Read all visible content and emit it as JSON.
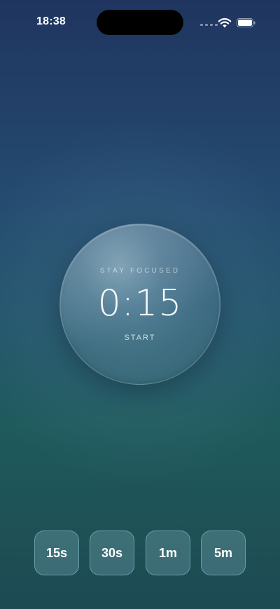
{
  "status_bar": {
    "time": "18:38",
    "icons": [
      "cellular-signal-icon",
      "wifi-icon",
      "battery-icon"
    ]
  },
  "timer": {
    "subtitle": "STAY FOCUSED",
    "time": "0:15",
    "action_label": "START"
  },
  "presets": [
    {
      "label": "15s"
    },
    {
      "label": "30s"
    },
    {
      "label": "1m"
    },
    {
      "label": "5m"
    }
  ],
  "colors": {
    "background_top": "#1f3560",
    "background_bottom": "#1d4a52",
    "preset_border": "#7fd0da",
    "text": "#ffffff"
  }
}
